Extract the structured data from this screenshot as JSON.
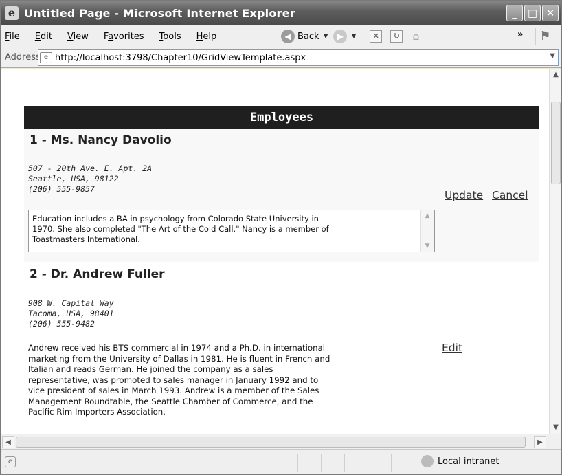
{
  "window": {
    "title": "Untitled Page - Microsoft Internet Explorer",
    "buttons": {
      "minimize": "_",
      "maximize": "□",
      "close": "✕"
    }
  },
  "menu": {
    "items": [
      {
        "key": "F",
        "rest": "ile"
      },
      {
        "key": "E",
        "rest": "dit"
      },
      {
        "key": "V",
        "rest": "iew"
      },
      {
        "pre": "F",
        "key": "a",
        "rest": "vorites"
      },
      {
        "key": "T",
        "rest": "ools"
      },
      {
        "key": "H",
        "rest": "elp"
      }
    ],
    "back_label": "Back",
    "chevron": "»"
  },
  "address": {
    "label": "Address",
    "url": "http://localhost:3798/Chapter10/GridViewTemplate.aspx"
  },
  "grid": {
    "header": "Employees",
    "rows": [
      {
        "title": "1 - Ms. Nancy Davolio",
        "address_line1": "507 - 20th Ave. E. Apt. 2A",
        "address_line2": "Seattle, USA, 98122",
        "phone": "(206) 555-9857",
        "notes_line1": "Education includes a BA in psychology from Colorado State University in",
        "notes_line2": "1970.  She also completed \"The Art of the Cold Call.\"  Nancy is a member of",
        "notes_line3": "Toastmasters International.",
        "update_label": "Update",
        "cancel_label": "Cancel"
      },
      {
        "title": "2 - Dr. Andrew Fuller",
        "address_line1": "908 W. Capital Way",
        "address_line2": "Tacoma, USA, 98401",
        "phone": "(206) 555-9482",
        "notes_lines": [
          "Andrew received his BTS commercial in 1974 and a Ph.D. in international",
          "marketing from the University of Dallas in 1981. He is fluent in French and",
          "Italian and reads German. He joined the company as a sales",
          "representative, was promoted to sales manager in January 1992 and to",
          "vice president of sales in March 1993. Andrew is a member of the Sales",
          "Management Roundtable, the Seattle Chamber of Commerce, and the",
          "Pacific Rim Importers Association."
        ],
        "edit_label": "Edit"
      }
    ]
  },
  "status": {
    "zone": "Local intranet"
  }
}
